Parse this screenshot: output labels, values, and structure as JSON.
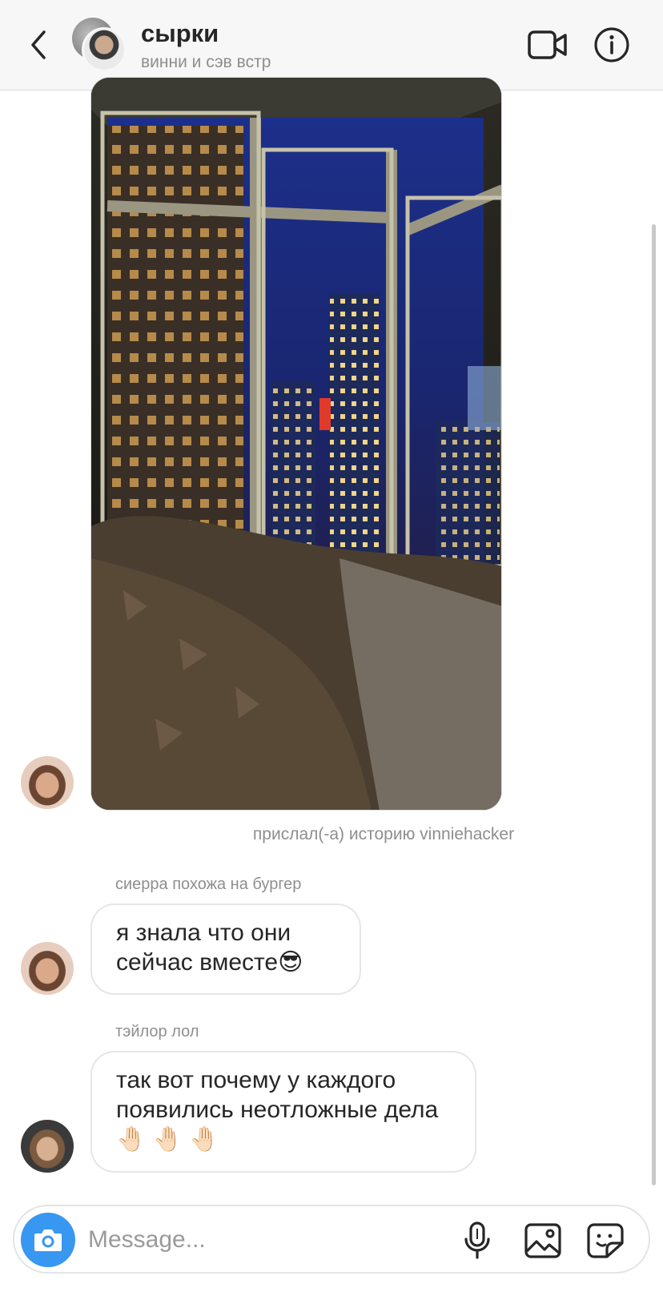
{
  "header": {
    "title": "сырки",
    "subtitle": "винни и сэв встр"
  },
  "story": {
    "caption": "прислал(-а) историю vinniehacker"
  },
  "messages": [
    {
      "sender": "сиерра похожа на бургер",
      "text": "я знала что они сейчас вместе😎"
    },
    {
      "sender": "тэйлор лол",
      "text": " так вот почему у каждого появились неотложные дела🤚🏻 🤚🏻 🤚🏻"
    }
  ],
  "composer": {
    "placeholder": "Message..."
  },
  "icons": {
    "back": "chevron-left-icon",
    "video": "video-camera-icon",
    "info": "info-icon",
    "camera": "camera-icon",
    "mic": "microphone-icon",
    "gallery": "image-icon",
    "sticker": "sticker-icon"
  },
  "colors": {
    "accent": "#3897f0",
    "header_bg": "#f7f7f7",
    "muted_text": "#8e8e8e",
    "text": "#262626"
  }
}
